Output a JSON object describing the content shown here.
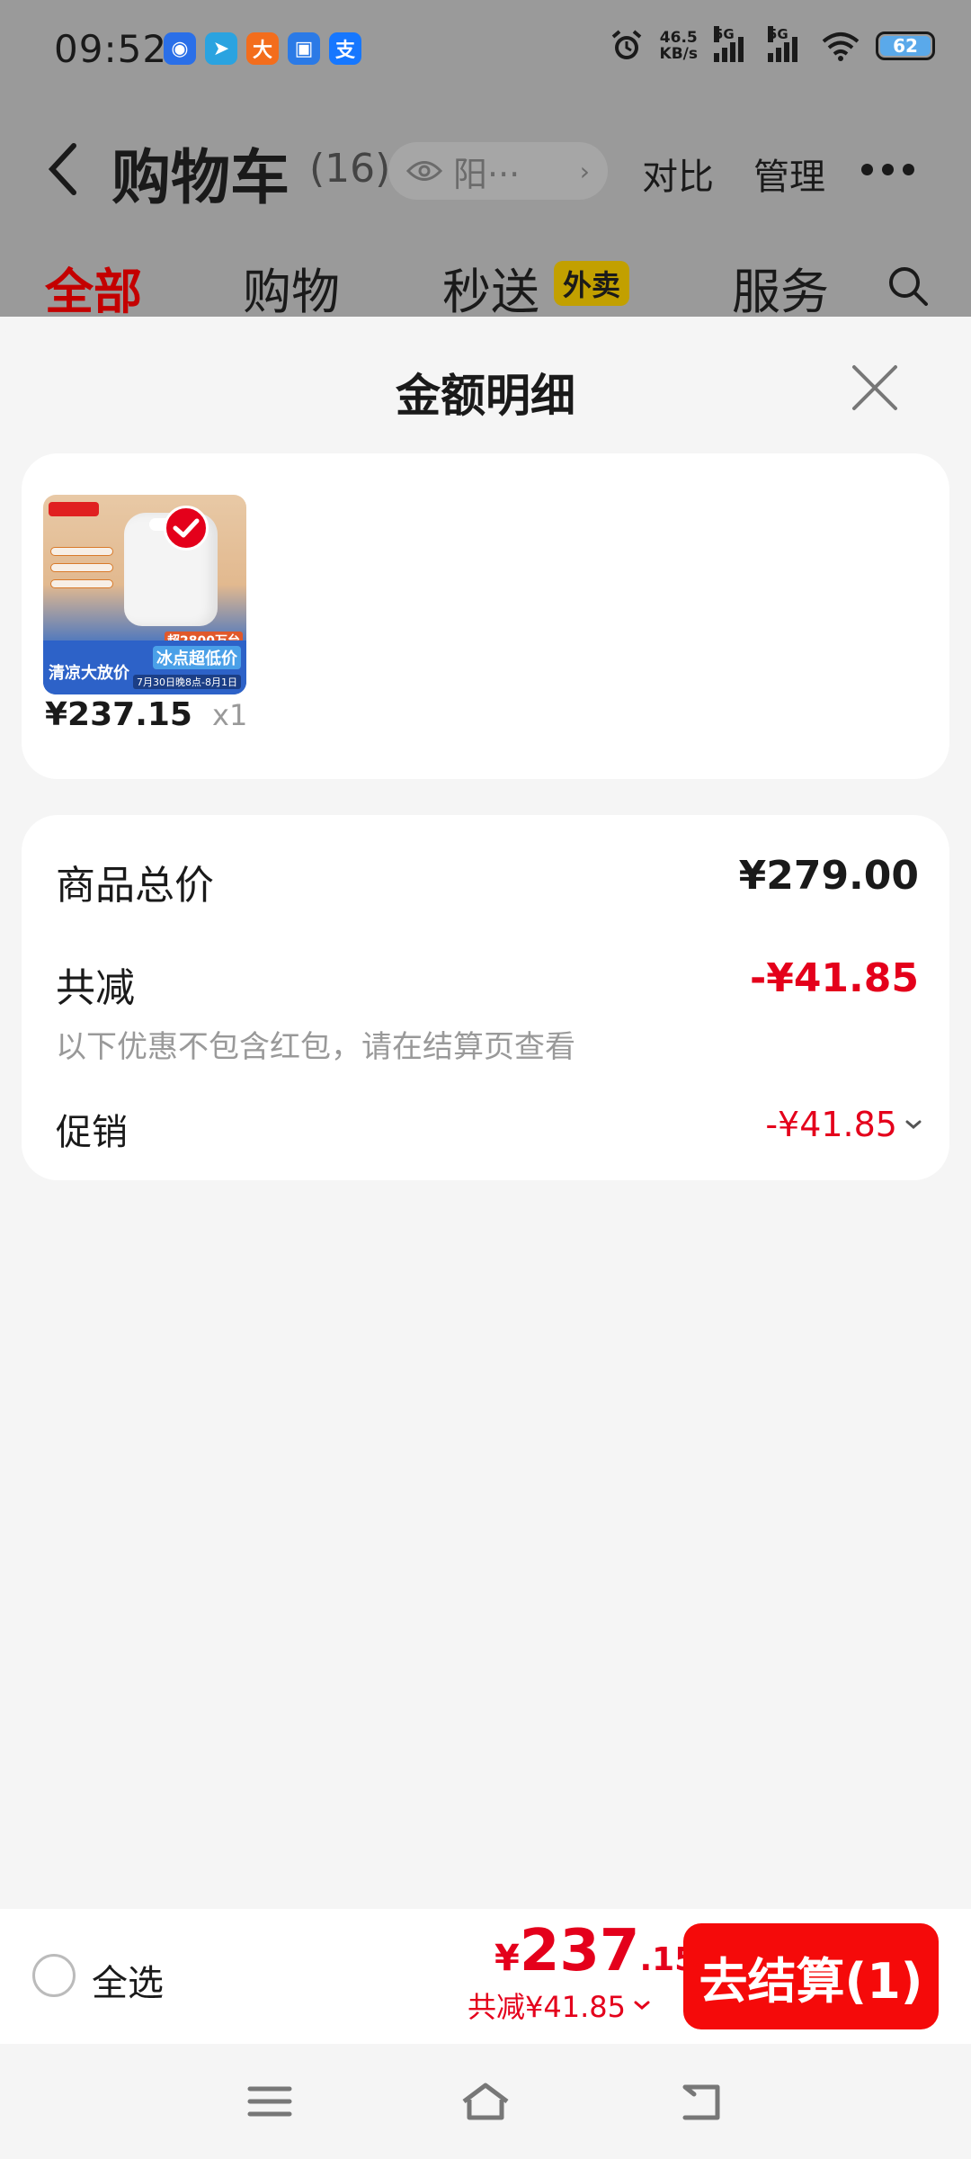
{
  "status_bar": {
    "time": "09:52",
    "net_speed_value": "46.5",
    "net_speed_unit": "KB/s",
    "signal_1": "5G",
    "signal_2": "5G",
    "battery": "62",
    "app_icons": [
      {
        "name": "app-icon-blue",
        "glyph": "◉",
        "color": "#2a6fe8"
      },
      {
        "name": "app-icon-telegram",
        "glyph": "➤",
        "color": "#2aa3e0"
      },
      {
        "name": "app-icon-orange",
        "glyph": "大",
        "color": "#f36d1c"
      },
      {
        "name": "app-icon-chat",
        "glyph": "▣",
        "color": "#2b7ae6"
      },
      {
        "name": "app-icon-alipay",
        "glyph": "支",
        "color": "#1677ff"
      }
    ]
  },
  "header": {
    "title": "购物车",
    "count": "(16)",
    "address": "阳···",
    "compare": "对比",
    "manage": "管理"
  },
  "tabs": [
    {
      "label": "全部",
      "active": true
    },
    {
      "label": "购物",
      "active": false
    },
    {
      "label": "秒送",
      "active": false
    },
    {
      "label": "服务",
      "active": false
    }
  ],
  "tab_badge": "外卖",
  "sheet": {
    "title": "金额明细",
    "goods": {
      "price": "¥237.15",
      "qty": "x1",
      "image_texts": {
        "left_banner": "清凉大放价",
        "right_banner": "冰点超低价",
        "date": "7月30日晚8点-8月1日",
        "sale": "超2800万台"
      }
    },
    "detail": {
      "total_label": "商品总价",
      "total_value": "¥279.00",
      "reduce_label": "共减",
      "reduce_value": "-¥41.85",
      "note": "以下优惠不包含红包，请在结算页查看",
      "promo_label": "促销",
      "promo_value": "-¥41.85"
    }
  },
  "bottom_bar": {
    "select_all": "全选",
    "yen": "¥",
    "total_int": "237",
    "total_dec": ".15",
    "saved": "共减¥41.85",
    "checkout": "去结算(1)"
  },
  "colors": {
    "accent_red": "#e4001b",
    "checkout_button": "#f50a0a",
    "dim_overlay": "#9a9a9a"
  }
}
